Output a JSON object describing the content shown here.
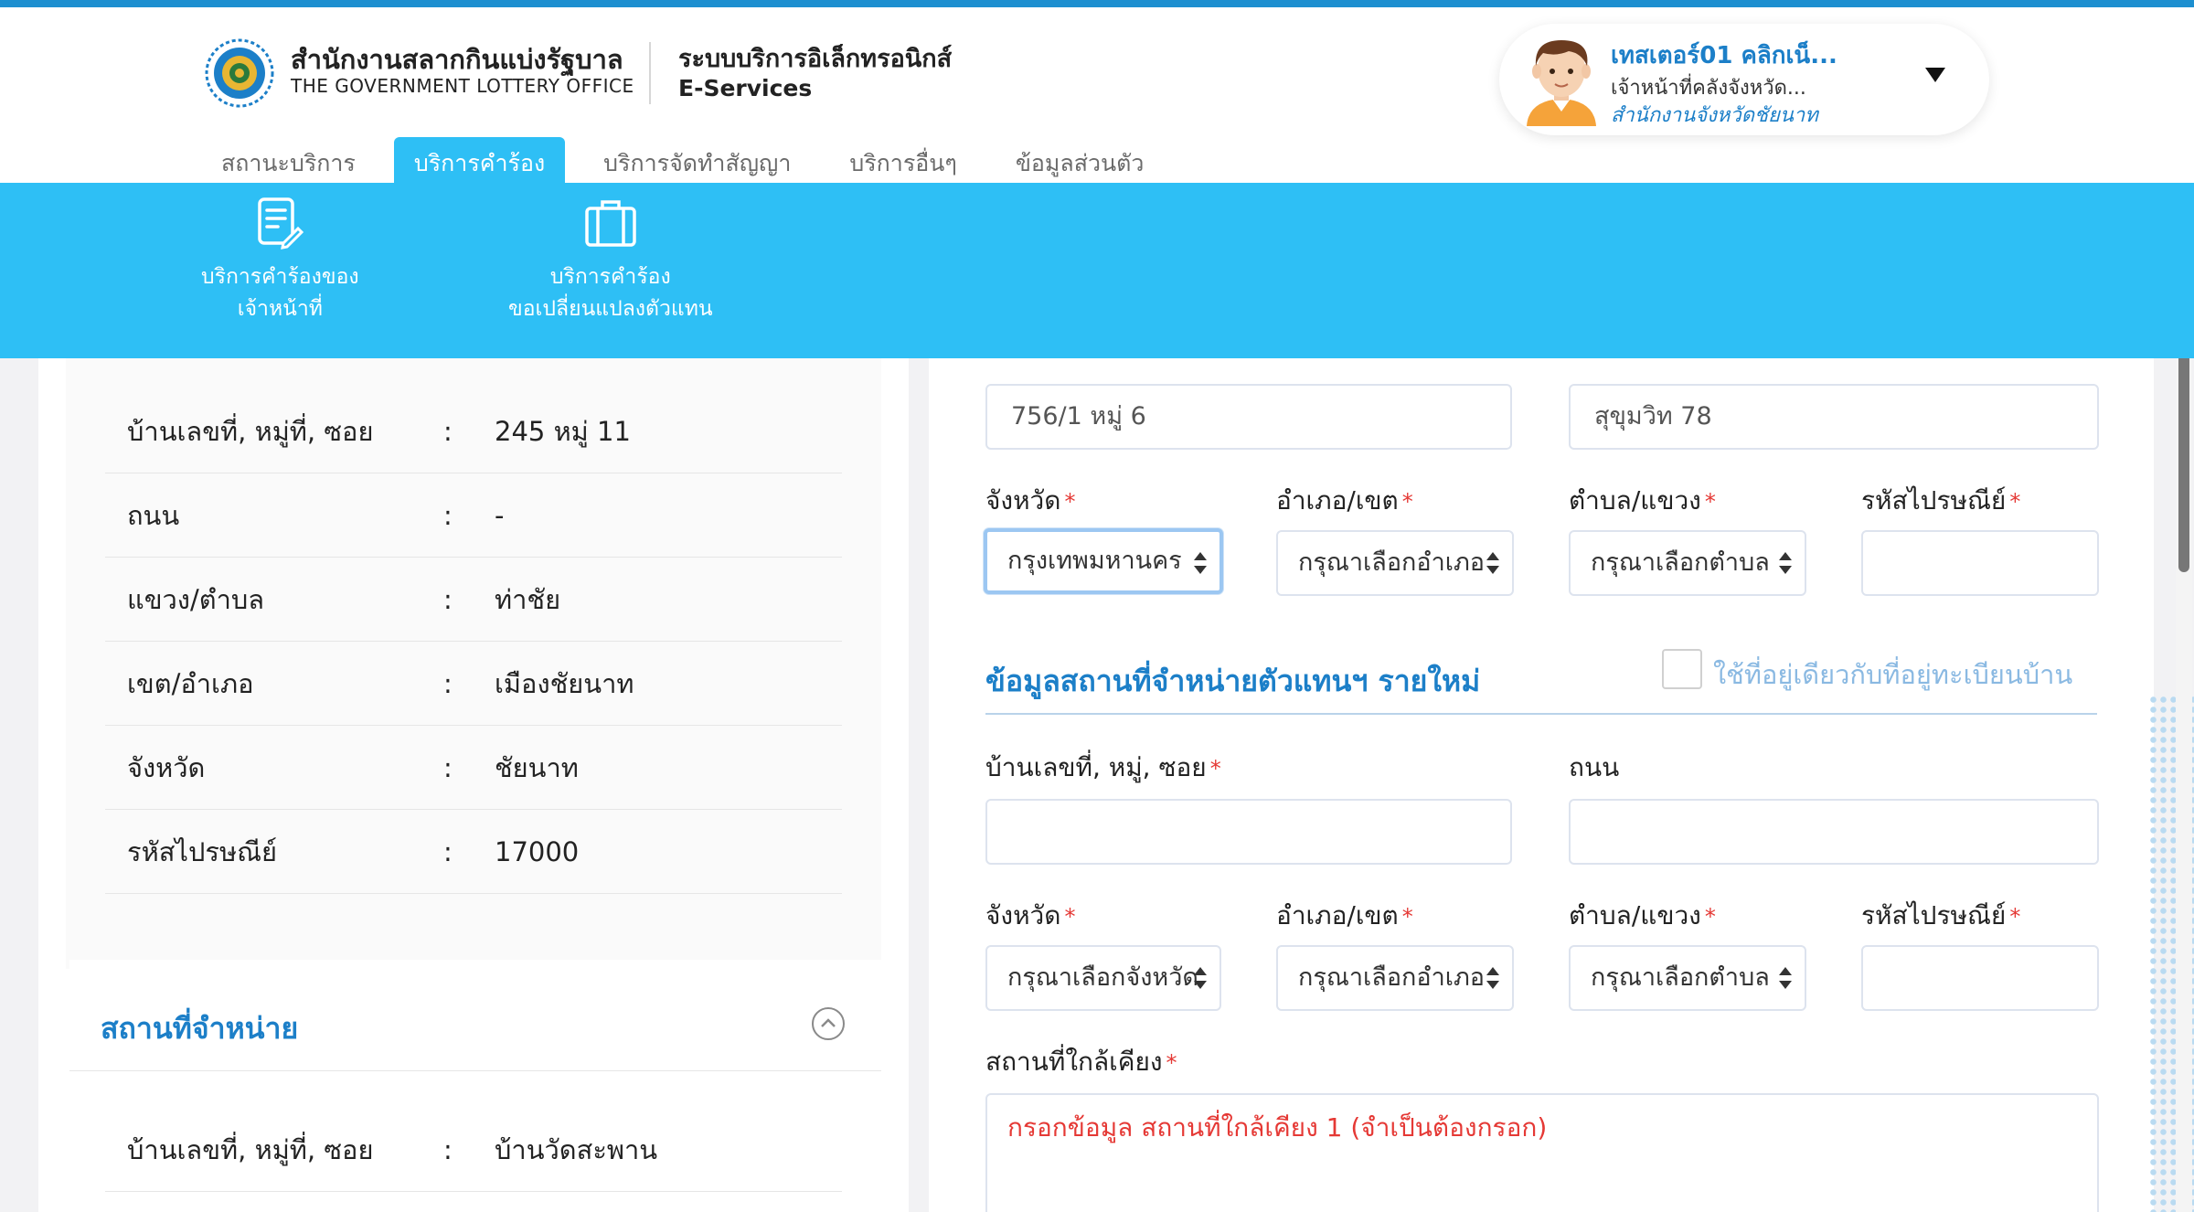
{
  "header": {
    "org_name_th": "สำนักงานสลากกินแบ่งรัฐบาล",
    "org_name_en": "THE GOVERNMENT LOTTERY OFFICE",
    "system_name_th": "ระบบบริการอิเล็กทรอนิกส์",
    "system_name_en": "E-Services"
  },
  "user": {
    "name": "เทสเตอร์01 คลิกเน็...",
    "role": "เจ้าหน้าที่คลังจังหวัด...",
    "office": "สำนักงานจังหวัดชัยนาท"
  },
  "tabs": [
    {
      "label": "สถานะบริการ"
    },
    {
      "label": "บริการคำร้อง"
    },
    {
      "label": "บริการจัดทำสัญญา"
    },
    {
      "label": "บริการอื่นๆ"
    },
    {
      "label": "ข้อมูลส่วนตัว"
    }
  ],
  "subnav": [
    {
      "line1": "บริการคำร้องของ",
      "line2": "เจ้าหน้าที่",
      "icon": "document-edit-icon"
    },
    {
      "line1": "บริการคำร้อง",
      "line2": "ขอเปลี่ยนแปลงตัวแทน",
      "icon": "briefcase-icon"
    }
  ],
  "left_info": {
    "rows": [
      {
        "label": "บ้านเลขที่, หมู่ที่, ซอย",
        "colon": ":",
        "value": "245 หมู่ 11"
      },
      {
        "label": "ถนน",
        "colon": ":",
        "value": "-"
      },
      {
        "label": "แขวง/ตำบล",
        "colon": ":",
        "value": "ท่าชัย"
      },
      {
        "label": "เขต/อำเภอ",
        "colon": ":",
        "value": "เมืองชัยนาท"
      },
      {
        "label": "จังหวัด",
        "colon": ":",
        "value": "ชัยนาท"
      },
      {
        "label": "รหัสไปรษณีย์",
        "colon": ":",
        "value": "17000"
      }
    ],
    "section_title": "สถานที่จำหน่าย",
    "section_rows": [
      {
        "label": "บ้านเลขที่, หมู่ที่, ซอย",
        "colon": ":",
        "value": "บ้านวัดสะพาน"
      }
    ]
  },
  "form_current": {
    "address_value": "756/1 หมู่ 6",
    "road_value": "สุขุมวิท 78",
    "province_label": "จังหวัด",
    "province_value": "กรุงเทพมหานคร",
    "district_label": "อำเภอ/เขต",
    "district_value": "กรุณาเลือกอำเภอ",
    "subdistrict_label": "ตำบล/แขวง",
    "subdistrict_value": "กรุณาเลือกตำบล",
    "postcode_label": "รหัสไปรษณีย์",
    "postcode_value": ""
  },
  "form_new": {
    "title": "ข้อมูลสถานที่จำหน่ายตัวแทนฯ รายใหม่",
    "same_address_label": "ใช้ที่อยู่เดียวกับที่อยู่ทะเบียนบ้าน",
    "address_label": "บ้านเลขที่, หมู่, ซอย",
    "address_value": "",
    "road_label": "ถนน",
    "road_value": "",
    "province_label": "จังหวัด",
    "province_value": "กรุณาเลือกจังหวัด",
    "district_label": "อำเภอ/เขต",
    "district_value": "กรุณาเลือกอำเภอ",
    "subdistrict_label": "ตำบล/แขวง",
    "subdistrict_value": "กรุณาเลือกตำบล",
    "postcode_label": "รหัสไปรษณีย์",
    "postcode_value": "",
    "nearby_label": "สถานที่ใกล้เคียง",
    "nearby_placeholder": "กรอกข้อมูล สถานที่ใกล้เคียง 1 (จำเป็นต้องกรอก)"
  },
  "required_mark": "*",
  "colors": {
    "brand_blue": "#1c7fc8",
    "subnav_bg": "#2ebff5",
    "required_red": "#e53935"
  }
}
